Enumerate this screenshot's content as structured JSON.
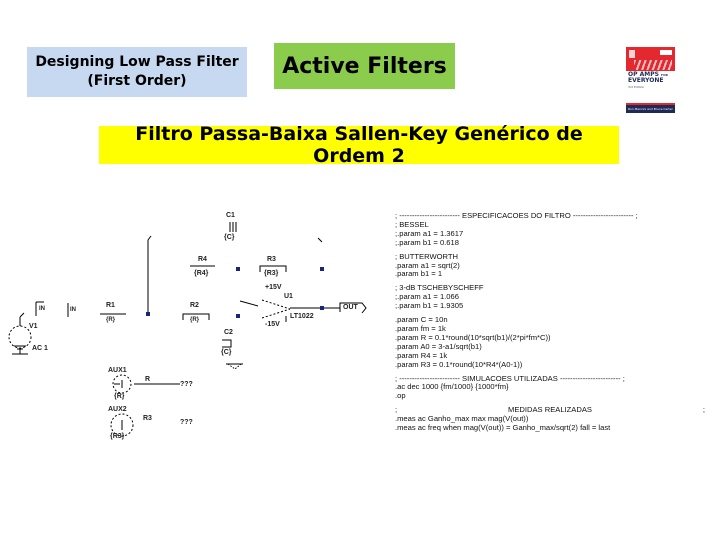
{
  "header": {
    "design_title_line1": "Designing Low Pass Filter",
    "design_title_line2": "(First Order)",
    "active_filters": "Active Filters",
    "sallen_key_title": "Filtro Passa-Baixa Sallen-Key Genérico de Ordem 2"
  },
  "book_cover": {
    "title_line1": "OP AMPS",
    "title_suffix": "FOR",
    "title_line2": "EVERYONE",
    "edition": "3rd Edition",
    "authors": "Ron Mancini and Bruce Carter",
    "colors": {
      "primary": "#e3292f",
      "band": "#1f2a57"
    }
  },
  "schematic": {
    "labels": {
      "c1": "C1",
      "c1_value": "{C}",
      "r4": "R4",
      "r4_value": "{R4}",
      "r3": "R3",
      "r3_value": "{R3}",
      "pos_supply": "+15V",
      "neg_supply": "-15V",
      "u1": "U1",
      "opamp_model": "LT1022",
      "out": "OUT",
      "in_port": "IN",
      "in_net": "IN",
      "r1": "R1",
      "r1_value": "{R}",
      "r2": "R2",
      "r2_value": "{R}",
      "c2": "C2",
      "c2_value": "{C}",
      "v1": "V1",
      "ac": "AC 1",
      "aux1": "AUX1",
      "aux1_value": "{R}",
      "aux1_net": "R",
      "aux1_unknown": "???",
      "aux2": "AUX2",
      "aux2_value": "{R3}",
      "aux2_net": "R3",
      "aux2_unknown": "???"
    },
    "wire_color": "#000000",
    "node_color": "#1a237e"
  },
  "spice": {
    "specs_header_left": "; ------------------------ ",
    "specs_header_title": "ESPECIFICACOES DO FILTRO",
    "specs_header_right": " ------------------------ ;",
    "bessel": [
      "; BESSEL",
      ";.param a1 = 1.3617",
      ";.param b1 = 0.618"
    ],
    "butterworth": [
      "; BUTTERWORTH",
      ".param a1 = sqrt(2)",
      ".param b1 = 1"
    ],
    "chebyshev": [
      "; 3-dB TSCHEBYSCHEFF",
      ";.param a1 = 1.066",
      ";.param b1 = 1.9305"
    ],
    "params": [
      ".param C = 10n",
      ".param fm = 1k",
      ".param R = 0.1*round(10*sqrt(b1)/(2*pi*fm*C))",
      ".param A0 = 3-a1/sqrt(b1)",
      ".param R4 = 1k",
      ".param R3 = 0.1*round(10*R4*(A0-1))"
    ],
    "sim_header_left": "; ------------------------ ",
    "sim_header_title": "SIMULACOES UTILIZADAS",
    "sim_header_right": " ------------------------ ;",
    "sims": [
      ".ac dec 1000 {fm/1000} {1000*fm}",
      ".op"
    ],
    "meas_header_left": ";",
    "meas_header_title": "MEDIDAS REALIZADAS",
    "meas_header_right": ";",
    "meas": [
      ".meas ac Ganho_max max mag(V(out))",
      ".meas ac freq when mag(V(out)) = Ganho_max/sqrt(2) fall = last"
    ]
  }
}
